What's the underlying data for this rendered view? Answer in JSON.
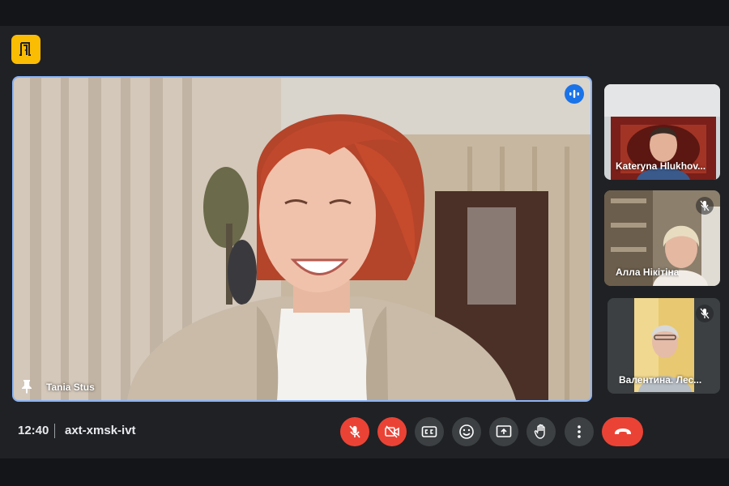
{
  "meeting": {
    "time": "12:40",
    "code": "axt-xmsk-ivt"
  },
  "main_speaker": {
    "name": "Tania Stus",
    "pinned": true,
    "speaking": true
  },
  "participants": [
    {
      "name": "Kateryna Hlukhov...",
      "muted": false
    },
    {
      "name": "Алла Нікітіна",
      "muted": true
    },
    {
      "name": "Валентина. Лес...",
      "muted": true
    }
  ],
  "controls": [
    {
      "icon": "mic-off-icon",
      "state": "off"
    },
    {
      "icon": "camera-off-icon",
      "state": "off"
    },
    {
      "icon": "captions-icon",
      "state": "normal"
    },
    {
      "icon": "emoji-icon",
      "state": "normal"
    },
    {
      "icon": "present-screen-icon",
      "state": "normal"
    },
    {
      "icon": "raise-hand-icon",
      "state": "normal"
    },
    {
      "icon": "more-options-icon",
      "state": "normal"
    },
    {
      "icon": "hang-up-icon",
      "state": "danger"
    }
  ],
  "colors": {
    "background": "#202124",
    "active_speaker_border": "#8ab4f8",
    "danger": "#ea4335",
    "control": "#3c4043",
    "brand": "#fbbc04",
    "speaking_indicator": "#1a73e8"
  }
}
